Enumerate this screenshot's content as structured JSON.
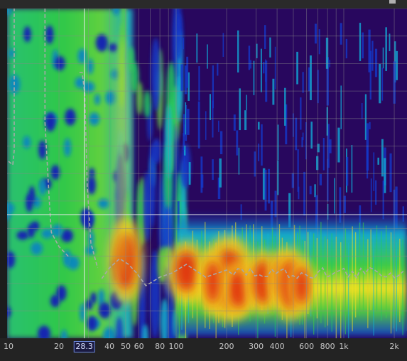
{
  "spectrogram": {
    "x_axis_ticks": [
      "10",
      "20",
      "40",
      "50",
      "60",
      "80",
      "100",
      "200",
      "300",
      "400",
      "600",
      "800",
      "1k",
      "2k"
    ],
    "x_axis_tick_values": [
      10,
      20,
      40,
      50,
      60,
      80,
      100,
      200,
      300,
      400,
      600,
      800,
      1000,
      2000
    ],
    "x_range_hz": [
      10,
      2300
    ],
    "x_scale": "log",
    "cursor": {
      "frequency_readout": "28.3",
      "frequency_hz": 28.3
    },
    "grid": true,
    "colormap": [
      "#28075e",
      "#1230c8",
      "#12b4d4",
      "#20c860",
      "#f0e020",
      "#e02010"
    ],
    "background_color": "#28075e"
  }
}
